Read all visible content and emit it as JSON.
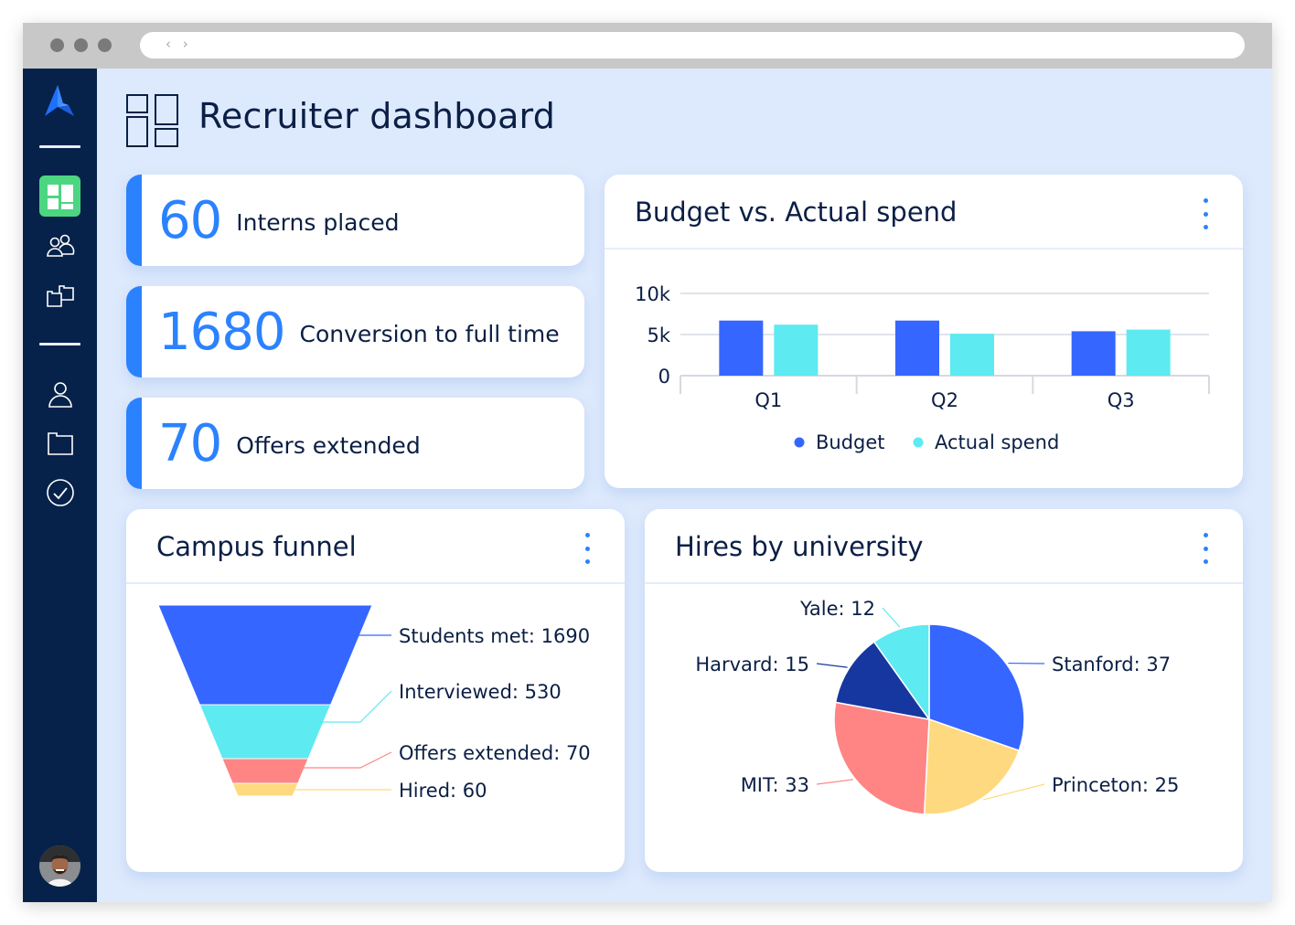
{
  "browser": {
    "nav_glyph": "‹ ›"
  },
  "sidebar": {
    "items": [
      {
        "name": "dashboard",
        "active": true
      },
      {
        "name": "team"
      },
      {
        "name": "projects"
      },
      {
        "name": "profile"
      },
      {
        "name": "files"
      },
      {
        "name": "tasks"
      }
    ],
    "active_color": "#4cd681"
  },
  "header": {
    "title": "Recruiter dashboard"
  },
  "kpis": [
    {
      "value": "60",
      "label": "Interns placed"
    },
    {
      "value": "1680",
      "label": "Conversion to full time"
    },
    {
      "value": "70",
      "label": "Offers extended"
    }
  ],
  "cards": {
    "budget": {
      "title": "Budget vs. Actual spend"
    },
    "funnel": {
      "title": "Campus funnel"
    },
    "university": {
      "title": "Hires by university"
    }
  },
  "colors": {
    "accent": "#2b82ff",
    "blue": "#3566ff",
    "cyan": "#5deaf0",
    "coral": "#ff8585",
    "yellow": "#ffd97f",
    "navy": "#1737a0",
    "text": "#0b1f45"
  },
  "chart_data": [
    {
      "type": "bar",
      "title": "Budget vs. Actual spend",
      "categories": [
        "Q1",
        "Q2",
        "Q3"
      ],
      "series": [
        {
          "name": "Budget",
          "color": "#3566ff",
          "values": [
            6700,
            6700,
            5400
          ]
        },
        {
          "name": "Actual spend",
          "color": "#5deaf0",
          "values": [
            6200,
            5100,
            5600
          ]
        }
      ],
      "yticks": [
        0,
        5000,
        10000
      ],
      "ytick_labels": [
        "0",
        "5k",
        "10k"
      ],
      "ylim": [
        0,
        10000
      ],
      "grid": true,
      "legend": "bottom"
    },
    {
      "type": "funnel",
      "title": "Campus funnel",
      "stages": [
        {
          "label": "Students met",
          "value": 1690,
          "color": "#3566ff",
          "text": "Students met: 1690"
        },
        {
          "label": "Interviewed",
          "value": 530,
          "color": "#5deaf0",
          "text": "Interviewed: 530"
        },
        {
          "label": "Offers extended",
          "value": 70,
          "color": "#ff8585",
          "text": "Offers extended: 70"
        },
        {
          "label": "Hired",
          "value": 60,
          "color": "#ffd97f",
          "text": "Hired: 60"
        }
      ]
    },
    {
      "type": "pie",
      "title": "Hires by university",
      "slices": [
        {
          "label": "Stanford",
          "value": 37,
          "color": "#3566ff",
          "text": "Stanford: 37"
        },
        {
          "label": "Princeton",
          "value": 25,
          "color": "#ffd97f",
          "text": "Princeton: 25"
        },
        {
          "label": "MIT",
          "value": 33,
          "color": "#ff8585",
          "text": "MIT: 33"
        },
        {
          "label": "Harvard",
          "value": 15,
          "color": "#1737a0",
          "text": "Harvard: 15"
        },
        {
          "label": "Yale",
          "value": 12,
          "color": "#5deaf0",
          "text": "Yale: 12"
        }
      ]
    }
  ]
}
